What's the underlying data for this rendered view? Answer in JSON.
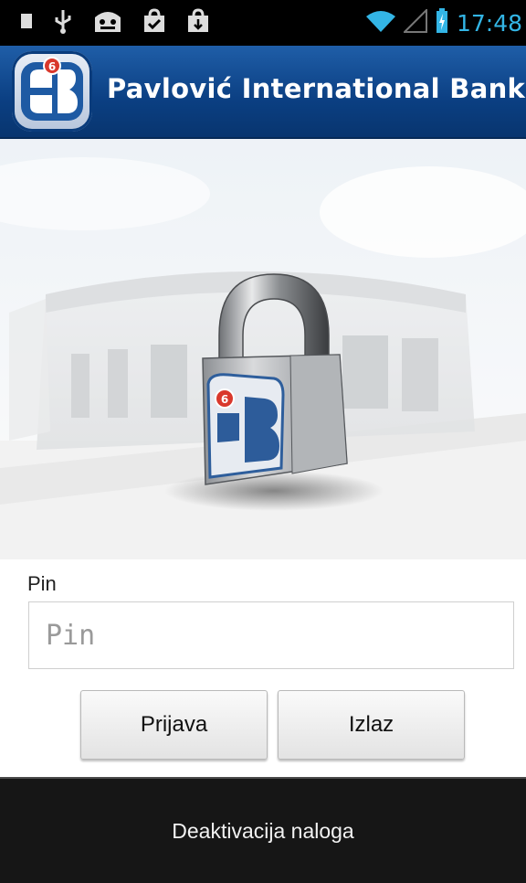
{
  "status_bar": {
    "time": "17:48",
    "icons": [
      "sim-card-icon",
      "usb-icon",
      "android-debug-icon",
      "bag-check-icon",
      "shopping-bag-icon",
      "wifi-icon",
      "signal-icon",
      "battery-charging-icon"
    ],
    "accent": "#33b5e5"
  },
  "app_bar": {
    "title": "Pavlović International Bank",
    "logo_badge": "6",
    "logo_letter": "B",
    "color": "#0b3f82"
  },
  "hero": {
    "lock_badge": "6",
    "lock_letter": "B"
  },
  "login": {
    "pin_label": "Pin",
    "pin_placeholder": "Pin",
    "pin_value": "",
    "login_button": "Prijava",
    "exit_button": "Izlaz"
  },
  "footer": {
    "deactivate_label": "Deaktivacija naloga"
  }
}
